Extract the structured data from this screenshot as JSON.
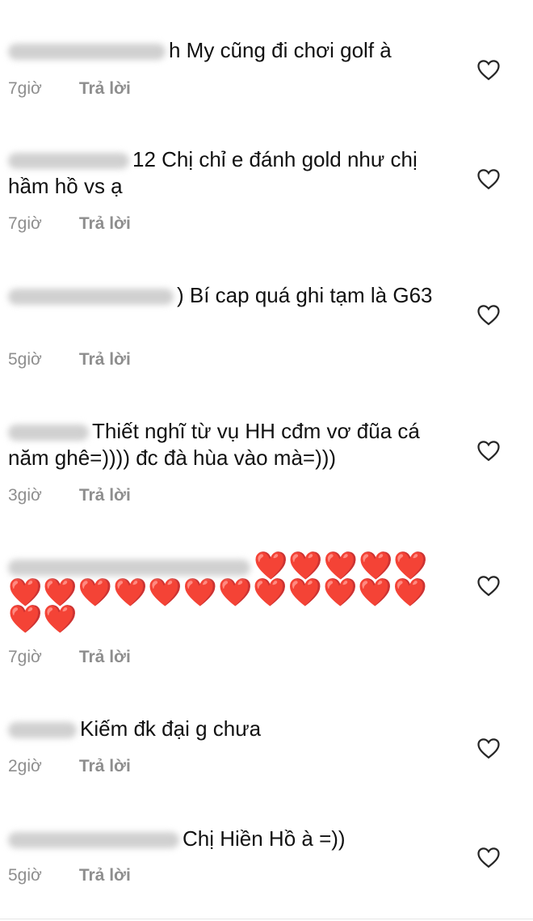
{
  "comments": [
    {
      "text": "h My cũng đi chơi golf à",
      "time": "7giờ",
      "reply": "Trả lời"
    },
    {
      "text": "12 Chị chỉ e đánh gold như chị hầm hồ vs ạ",
      "time": "7giờ",
      "reply": "Trả lời"
    },
    {
      "text": ") Bí cap quá ghi tạm là G63",
      "time": "5giờ",
      "reply": "Trả lời"
    },
    {
      "text": "Thiết nghĩ từ vụ HH cđm vơ đũa cá năm ghê=)))) đc đà hùa vào mà=)))",
      "time": "3giờ",
      "reply": "Trả lời"
    },
    {
      "text": "❤️❤️❤️❤️❤️❤️❤️❤️❤️❤️❤️❤️❤️❤️❤️❤️❤️❤️❤️",
      "time": "7giờ",
      "reply": "Trả lời"
    },
    {
      "text": "Kiếm đk đại g chưa",
      "time": "2giờ",
      "reply": "Trả lời"
    },
    {
      "text": "Chị Hiền Hồ à =))",
      "time": "5giờ",
      "reply": "Trả lời"
    }
  ],
  "icons": {
    "like": "heart-outline-icon"
  }
}
